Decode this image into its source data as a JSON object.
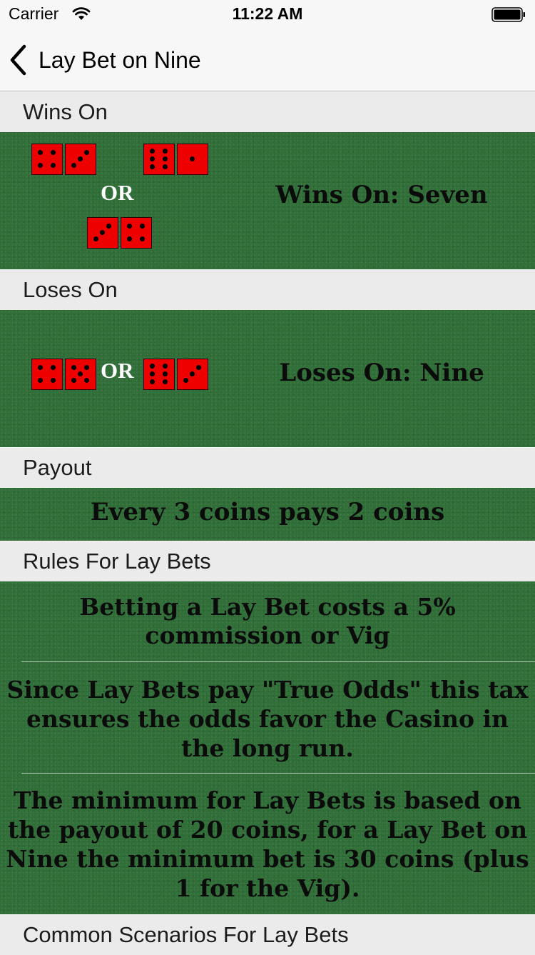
{
  "status_bar": {
    "carrier": "Carrier",
    "time": "11:22 AM"
  },
  "nav": {
    "back_icon": "chevron-left-icon",
    "title": "Lay Bet on Nine"
  },
  "sections": {
    "wins": {
      "header": "Wins On",
      "or_label": "OR",
      "result_text": "Wins On: Seven",
      "dice_pairs": [
        [
          4,
          3
        ],
        [
          6,
          1
        ],
        [
          3,
          4
        ]
      ]
    },
    "loses": {
      "header": "Loses On",
      "or_label": "OR",
      "result_text": "Loses On: Nine",
      "dice_pairs": [
        [
          4,
          5
        ],
        [
          6,
          3
        ]
      ]
    },
    "payout": {
      "header": "Payout",
      "text": "Every 3 coins pays 2 coins"
    },
    "rules": {
      "header": "Rules For Lay Bets",
      "items": [
        "Betting a Lay Bet costs a 5% commission or Vig",
        "Since Lay Bets pay \"True Odds\" this tax ensures the odds favor the Casino in the long run.",
        "The minimum for Lay Bets is based on the payout of 20 coins, for a Lay Bet on Nine the minimum bet is 30 coins (plus 1 for the Vig)."
      ]
    },
    "scenarios": {
      "header": "Common Scenarios For Lay Bets"
    }
  },
  "colors": {
    "felt": "#2c6a35",
    "die": "#ee0000",
    "pip": "#000000",
    "header_bg": "#ebebeb"
  }
}
